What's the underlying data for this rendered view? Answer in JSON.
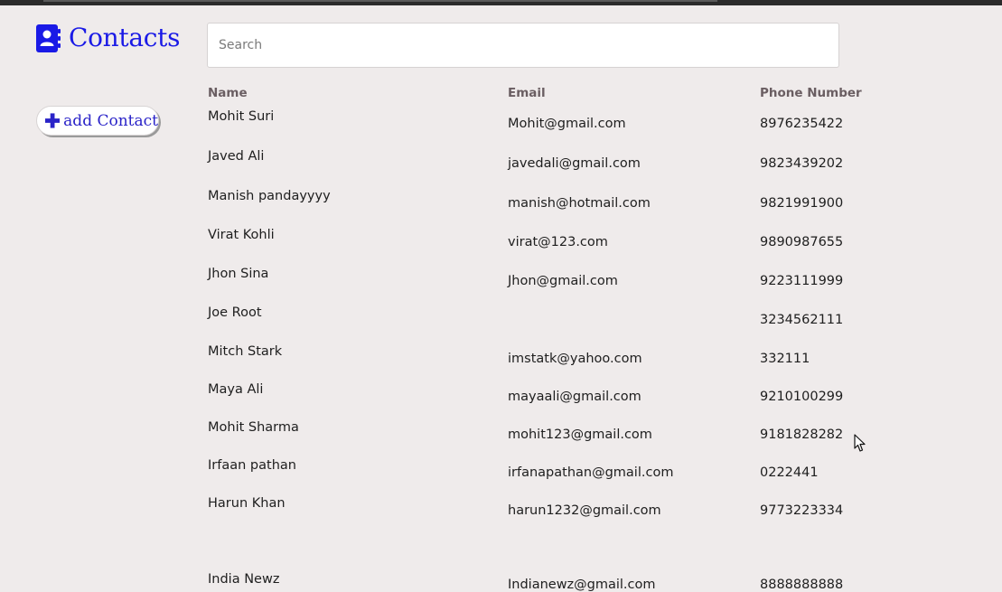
{
  "app": {
    "title": "Contacts",
    "icon": "address-book-icon",
    "accent_color": "#1a1ae6"
  },
  "sidebar": {
    "add_button_label": "add Contact",
    "add_button_icon": "plus-icon"
  },
  "search": {
    "placeholder": "Search",
    "value": ""
  },
  "table": {
    "headers": {
      "name": "Name",
      "email": "Email",
      "phone": "Phone Number"
    },
    "rows": [
      {
        "name": "Mohit Suri",
        "email": "Mohit@gmail.com",
        "phone": "8976235422"
      },
      {
        "name": "Javed  Ali",
        "email": "javedali@gmail.com",
        "phone": "9823439202"
      },
      {
        "name": "Manish pandayyyy",
        "email": "manish@hotmail.com",
        "phone": "9821991900"
      },
      {
        "name": "Virat Kohli",
        "email": "virat@123.com",
        "phone": "9890987655"
      },
      {
        "name": "Jhon Sina",
        "email": "Jhon@gmail.com",
        "phone": "9223111999"
      },
      {
        "name": "Joe Root",
        "email": "",
        "phone": "3234562111"
      },
      {
        "name": "Mitch Stark",
        "email": "imstatk@yahoo.com",
        "phone": "332111"
      },
      {
        "name": "Maya Ali",
        "email": "mayaali@gmail.com",
        "phone": "9210100299"
      },
      {
        "name": "Mohit Sharma",
        "email": "mohit123@gmail.com",
        "phone": "9181828282"
      },
      {
        "name": "Irfaan pathan",
        "email": "irfanapathan@gmail.com",
        "phone": "0222441"
      },
      {
        "name": "Harun Khan",
        "email": "harun1232@gmail.com",
        "phone": "9773223334"
      },
      {
        "name": "India Newz",
        "email": "Indianewz@gmail.com",
        "phone": "8888888888"
      }
    ]
  }
}
